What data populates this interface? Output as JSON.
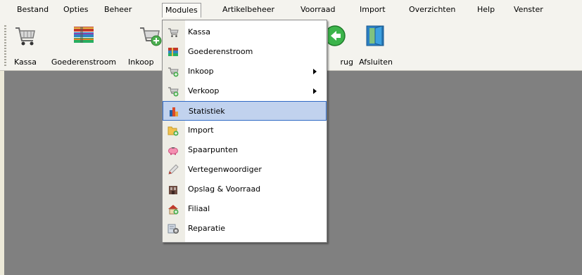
{
  "menubar": {
    "items": [
      "Bestand",
      "Opties",
      "Beheer",
      "Modules",
      "Artikelbeheer",
      "Voorraad",
      "Import",
      "Overzichten",
      "Help",
      "Venster"
    ],
    "active": "Modules"
  },
  "toolbar": {
    "buttons": [
      {
        "label": "Kassa",
        "icon": "shopping-cart-icon"
      },
      {
        "label": "Goederenstroom",
        "icon": "stacked-books-icon"
      },
      {
        "label": "Inkoop",
        "icon": "cart-plus-icon"
      },
      {
        "label": "Terug",
        "icon": "back-arrow-icon"
      },
      {
        "label": "Afsluiten",
        "icon": "exit-door-icon"
      }
    ]
  },
  "modules_menu": {
    "items": [
      {
        "label": "Kassa",
        "icon": "shopping-cart-icon",
        "submenu": false
      },
      {
        "label": "Goederenstroom",
        "icon": "stacked-books-icon",
        "submenu": false
      },
      {
        "label": "Inkoop",
        "icon": "cart-plus-icon",
        "submenu": true
      },
      {
        "label": "Verkoop",
        "icon": "cart-plus-icon",
        "submenu": true
      },
      {
        "label": "Statistiek",
        "icon": "bar-chart-icon",
        "submenu": false,
        "selected": true
      },
      {
        "label": "Import",
        "icon": "folder-add-icon",
        "submenu": false
      },
      {
        "label": "Spaarpunten",
        "icon": "piggy-bank-icon",
        "submenu": false
      },
      {
        "label": "Vertegenwoordiger",
        "icon": "pen-icon",
        "submenu": false
      },
      {
        "label": "Opslag & Voorraad",
        "icon": "warehouse-icon",
        "submenu": false
      },
      {
        "label": "Filiaal",
        "icon": "house-icon",
        "submenu": false
      },
      {
        "label": "Reparatie",
        "icon": "repair-icon",
        "submenu": false
      }
    ]
  },
  "colors": {
    "chrome": "#f4f3ee",
    "workspace": "#808080",
    "selection_fill": "#c1d2ee",
    "selection_border": "#316ac5"
  }
}
